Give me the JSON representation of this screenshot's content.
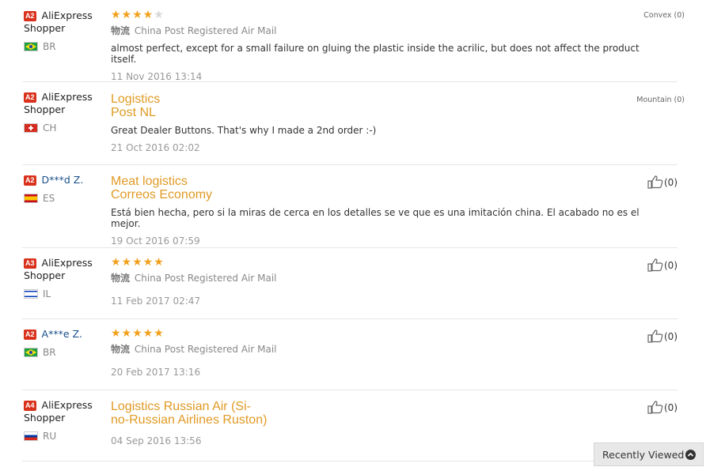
{
  "reviews": [
    {
      "level": "A2",
      "buyer": "AliExpress\nShopper",
      "country": "BR",
      "rating": 4,
      "right_label": "Convex (0)",
      "logistics_icon": "物流",
      "logistics": "China Post Registered Air Mail",
      "feedback": "almost perfect, except for a small failure on gluing the plastic inside the acrilic, but does not affect the product itself.",
      "date": "11 Nov 2016 13:14"
    },
    {
      "level": "A2",
      "buyer": "AliExpress\nShopper",
      "country": "CH",
      "shipping_title": "Logistics\nPost NL",
      "right_label": "Mountain (0)",
      "feedback": "Great Dealer Buttons. That's why I made a 2nd order :-)",
      "date": "21 Oct 2016 02:02"
    },
    {
      "level": "A2",
      "buyer": "D***d Z.",
      "country": "ES",
      "shipping_title": "Meat logistics\nCorreos Economy",
      "helpful": "(0)",
      "feedback": "Está bien hecha, pero si la miras de cerca en los detalles se ve que es una imitación china. El acabado no es el mejor.",
      "date": "19 Oct 2016 07:59"
    },
    {
      "level": "A3",
      "buyer": "AliExpress\nShopper",
      "country": "IL",
      "rating": 5,
      "helpful": "(0)",
      "logistics_icon": "物流",
      "logistics": "China Post Registered Air Mail",
      "date": "11 Feb 2017 02:47"
    },
    {
      "level": "A2",
      "buyer": "A***e Z.",
      "country": "BR",
      "rating": 5,
      "helpful": "(0)",
      "logistics_icon": "物流",
      "logistics": "China Post Registered Air Mail",
      "date": "20 Feb 2017 13:16"
    },
    {
      "level": "A4",
      "buyer": "AliExpress\nShopper",
      "country": "RU",
      "shipping_title": "Logistics Russian Air (Si-\nno-Russian Airlines Ruston)",
      "helpful": "(0)",
      "date": "04 Sep 2016 13:56"
    }
  ],
  "stars_full": "★★★★",
  "stars_five": "★★★★★",
  "star_dim": "★",
  "recently_viewed": "Recently Viewed",
  "colors": {
    "star": "#f2a01c",
    "shipping_title": "#e09a24",
    "level_badge": "#d9321c"
  }
}
